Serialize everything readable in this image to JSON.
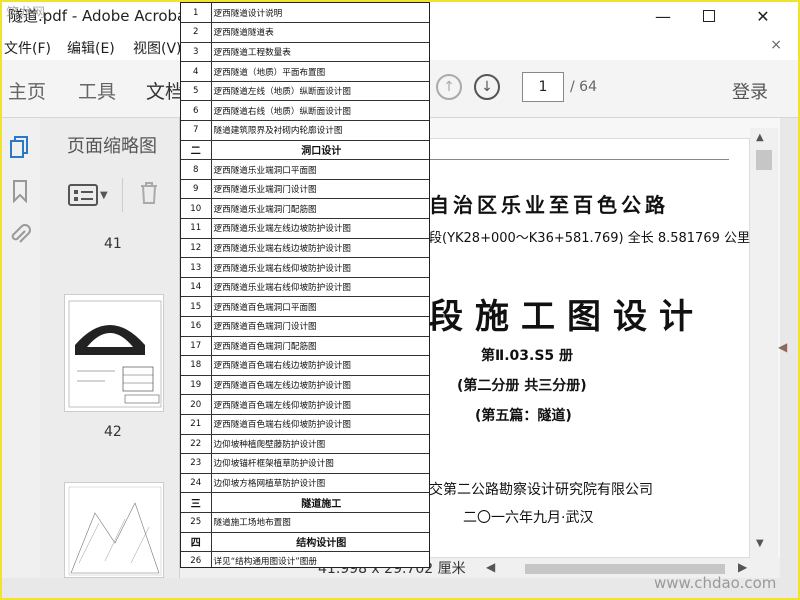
{
  "window": {
    "title": "隧道.pdf - Adobe Acrobat Reader DC",
    "min_glyph": "—",
    "close_glyph": "✕"
  },
  "watermark": {
    "top": "筑龙网",
    "bottom": "www.chdao.com"
  },
  "menu": {
    "items": [
      "文件(F)",
      "编辑(E)",
      "视图(V)"
    ],
    "close_glyph": "×"
  },
  "tabs": {
    "home": "主页",
    "tools": "工具",
    "document": "文档"
  },
  "navigation": {
    "current_page": "1",
    "total_pages": "/ 64",
    "up_glyph": "↑",
    "down_glyph": "↓"
  },
  "login_label": "登录",
  "thumbnail_panel": {
    "title": "页面缩略图",
    "page_labels": [
      "41",
      "42"
    ]
  },
  "document": {
    "title_line1": "自治区乐业至百色公路",
    "title_line2": "段(YK28+000～K36+581.769)  全长 8.581769 公里",
    "title_big": "段施工图设计",
    "volume": "第Ⅱ.03.S5 册",
    "part": "(第二分册  共三分册)",
    "chapter": "(第五篇：隧道)",
    "institute": "交第二公路勘察设计研究院有限公司",
    "date": "二〇一六年九月·武汉",
    "page_size": "41.998 x 29.702 厘米"
  },
  "toc": [
    {
      "no": "1",
      "title": "逻西隧道设计说明",
      "section": false
    },
    {
      "no": "2",
      "title": "逻西隧道隧道表",
      "section": false
    },
    {
      "no": "3",
      "title": "逻西隧道工程数量表",
      "section": false
    },
    {
      "no": "4",
      "title": "逻西隧道（地质）平面布置图",
      "section": false
    },
    {
      "no": "5",
      "title": "逻西隧道左线（地质）纵断面设计图",
      "section": false
    },
    {
      "no": "6",
      "title": "逻西隧道右线（地质）纵断面设计图",
      "section": false
    },
    {
      "no": "7",
      "title": "隧道建筑限界及衬砌内轮廓设计图",
      "section": false
    },
    {
      "no": "二",
      "title": "洞口设计",
      "section": true
    },
    {
      "no": "8",
      "title": "逻西隧道乐业端洞口平面图",
      "section": false
    },
    {
      "no": "9",
      "title": "逻西隧道乐业端洞门设计图",
      "section": false
    },
    {
      "no": "10",
      "title": "逻西隧道乐业端洞门配筋图",
      "section": false
    },
    {
      "no": "11",
      "title": "逻西隧道乐业端左线边坡防护设计图",
      "section": false
    },
    {
      "no": "12",
      "title": "逻西隧道乐业端右线边坡防护设计图",
      "section": false
    },
    {
      "no": "13",
      "title": "逻西隧道乐业端右线仰坡防护设计图",
      "section": false
    },
    {
      "no": "14",
      "title": "逻西隧道乐业端右线仰坡防护设计图",
      "section": false
    },
    {
      "no": "15",
      "title": "逻西隧道百色端洞口平面图",
      "section": false
    },
    {
      "no": "16",
      "title": "逻西隧道百色端洞门设计图",
      "section": false
    },
    {
      "no": "17",
      "title": "逻西隧道百色端洞门配筋图",
      "section": false
    },
    {
      "no": "18",
      "title": "逻西隧道百色端右线边坡防护设计图",
      "section": false
    },
    {
      "no": "19",
      "title": "逻西隧道百色端左线边坡防护设计图",
      "section": false
    },
    {
      "no": "20",
      "title": "逻西隧道百色端左线仰坡防护设计图",
      "section": false
    },
    {
      "no": "21",
      "title": "逻西隧道百色端右线仰坡防护设计图",
      "section": false
    },
    {
      "no": "22",
      "title": "边仰坡种植爬壁藤防护设计图",
      "section": false
    },
    {
      "no": "23",
      "title": "边仰坡锚杆框架植草防护设计图",
      "section": false
    },
    {
      "no": "24",
      "title": "边仰坡方格网植草防护设计图",
      "section": false
    },
    {
      "no": "三",
      "title": "隧道施工",
      "section": true
    },
    {
      "no": "25",
      "title": "隧道施工场地布置图",
      "section": false
    },
    {
      "no": "四",
      "title": "结构设计图",
      "section": true
    },
    {
      "no": "26",
      "title": "详见“结构通用图设计”图册",
      "section": false
    }
  ]
}
